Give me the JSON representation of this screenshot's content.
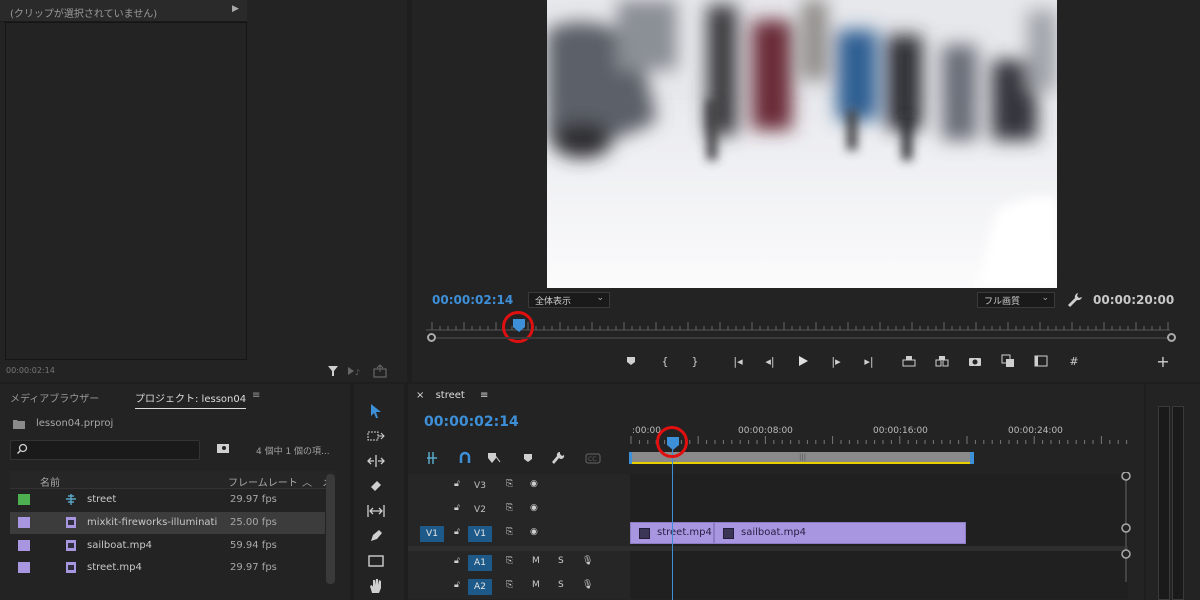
{
  "source_monitor": {
    "title": "(クリップが選択されていません)",
    "timecode": "00:00:02:14"
  },
  "program_monitor": {
    "timecode": "00:00:02:14",
    "zoom_value": "全体表示",
    "quality_value": "フル画質",
    "duration": "00:00:20:00"
  },
  "project_panel": {
    "tabs": [
      {
        "label": "メディアブラウザー"
      },
      {
        "label": "プロジェクト: lesson04"
      },
      {
        "label": "≡"
      }
    ],
    "project_file": "lesson04.prproj",
    "item_count": "4 個中 1 個の項...",
    "columns": {
      "name": "名前",
      "fps": "フレームレート",
      "more": "メ"
    },
    "rows": [
      {
        "name": "street",
        "fps": "29.97 fps",
        "color": "#4caf50",
        "type": "sequence"
      },
      {
        "name": "mixkit-fireworks-illuminatin",
        "fps": "25.00 fps",
        "color": "#a896e0",
        "type": "video"
      },
      {
        "name": "sailboat.mp4",
        "fps": "59.94 fps",
        "color": "#a896e0",
        "type": "video"
      },
      {
        "name": "street.mp4",
        "fps": "29.97 fps",
        "color": "#a896e0",
        "type": "video"
      }
    ]
  },
  "timeline": {
    "close": "×",
    "sequence_name": "street",
    "menu": "≡",
    "timecode": "00:00:02:14",
    "ruler": [
      ":00:00",
      "00:00:08:00",
      "00:00:16:00",
      "00:00:24:00"
    ],
    "tracks": [
      {
        "name": "V3",
        "kind": "video"
      },
      {
        "name": "V2",
        "kind": "video"
      },
      {
        "name": "V1",
        "kind": "video",
        "source": "V1"
      },
      {
        "name": "A1",
        "kind": "audio",
        "mute": "M",
        "solo": "S"
      },
      {
        "name": "A2",
        "kind": "audio",
        "mute": "M",
        "solo": "S"
      }
    ],
    "clips": [
      {
        "name": "street.mp4"
      },
      {
        "name": "sailboat.mp4"
      }
    ]
  },
  "colors": {
    "accent_blue": "#3d8fd8",
    "clip_purple": "#a896e0",
    "highlight_red": "#e01010",
    "workarea_yellow": "#e8d000"
  }
}
